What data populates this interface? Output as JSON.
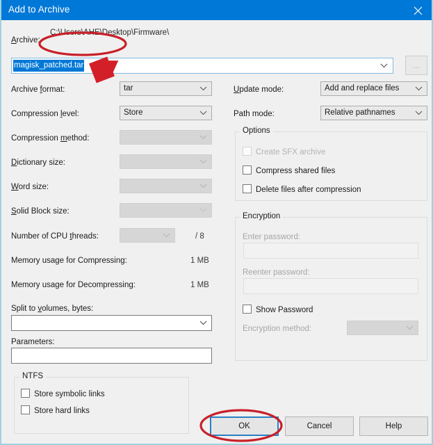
{
  "window": {
    "title": "Add to Archive",
    "close_icon": "close-icon"
  },
  "archive": {
    "label": "Archive:",
    "path": "C:\\Users\\\u0000\u0000\u0000\\Desktop\\Firmware\\",
    "path_display": "C:\\Users\\AHE\\Desktop\\Firmware\\",
    "filename": "magisk_patched.tar",
    "browse_label": "...",
    "chevron_icon": "chevron-down-icon"
  },
  "left": {
    "archive_format": {
      "label": "Archive format:",
      "value": "tar",
      "enabled": true
    },
    "compression_level": {
      "label": "Compression level:",
      "value": "Store",
      "enabled": true
    },
    "compression_method": {
      "label": "Compression method:",
      "value": "",
      "enabled": false
    },
    "dictionary_size": {
      "label": "Dictionary size:",
      "value": "",
      "enabled": false
    },
    "word_size": {
      "label": "Word size:",
      "value": "",
      "enabled": false
    },
    "solid_block_size": {
      "label": "Solid Block size:",
      "value": "",
      "enabled": false
    },
    "cpu_threads": {
      "label": "Number of CPU threads:",
      "value": "",
      "enabled": false,
      "total": "/ 8"
    },
    "memory_compress": {
      "label": "Memory usage for Compressing:",
      "value": "1 MB"
    },
    "memory_decompress": {
      "label": "Memory usage for Decompressing:",
      "value": "1 MB"
    },
    "split_volumes": {
      "label": "Split to volumes, bytes:",
      "value": ""
    },
    "parameters": {
      "label": "Parameters:",
      "value": ""
    }
  },
  "ntfs": {
    "title": "NTFS",
    "store_symbolic_links": {
      "label": "Store symbolic links",
      "checked": false
    },
    "store_hard_links": {
      "label": "Store hard links",
      "checked": false
    }
  },
  "right": {
    "update_mode": {
      "label": "Update mode:",
      "value": "Add and replace files",
      "enabled": true
    },
    "path_mode": {
      "label": "Path mode:",
      "value": "Relative pathnames",
      "enabled": true
    }
  },
  "options": {
    "title": "Options",
    "create_sfx": {
      "label": "Create SFX archive",
      "checked": false,
      "enabled": false
    },
    "compress_shared": {
      "label": "Compress shared files",
      "checked": false,
      "enabled": true
    },
    "delete_after": {
      "label": "Delete files after compression",
      "checked": false,
      "enabled": true
    }
  },
  "encryption": {
    "title": "Encryption",
    "enter_password": {
      "label": "Enter password:",
      "value": "",
      "enabled": false
    },
    "reenter_password": {
      "label": "Reenter password:",
      "value": "",
      "enabled": false
    },
    "show_password": {
      "label": "Show Password",
      "checked": false,
      "enabled": true
    },
    "method": {
      "label": "Encryption method:",
      "value": "",
      "enabled": false
    }
  },
  "buttons": {
    "ok": "OK",
    "cancel": "Cancel",
    "help": "Help"
  },
  "annotations": {
    "ellipse_archive_name": "red-ellipse-annotation",
    "arrow_archive_format": "red-arrow-annotation",
    "ellipse_ok_button": "red-ellipse-annotation",
    "color": "#c8202a"
  },
  "colors": {
    "titlebar": "#0078d7",
    "dialog_bg": "#f0f0f0",
    "selection": "#0078d7",
    "annotation_red": "#c8202a",
    "frame_border": "#9fd2e0"
  }
}
